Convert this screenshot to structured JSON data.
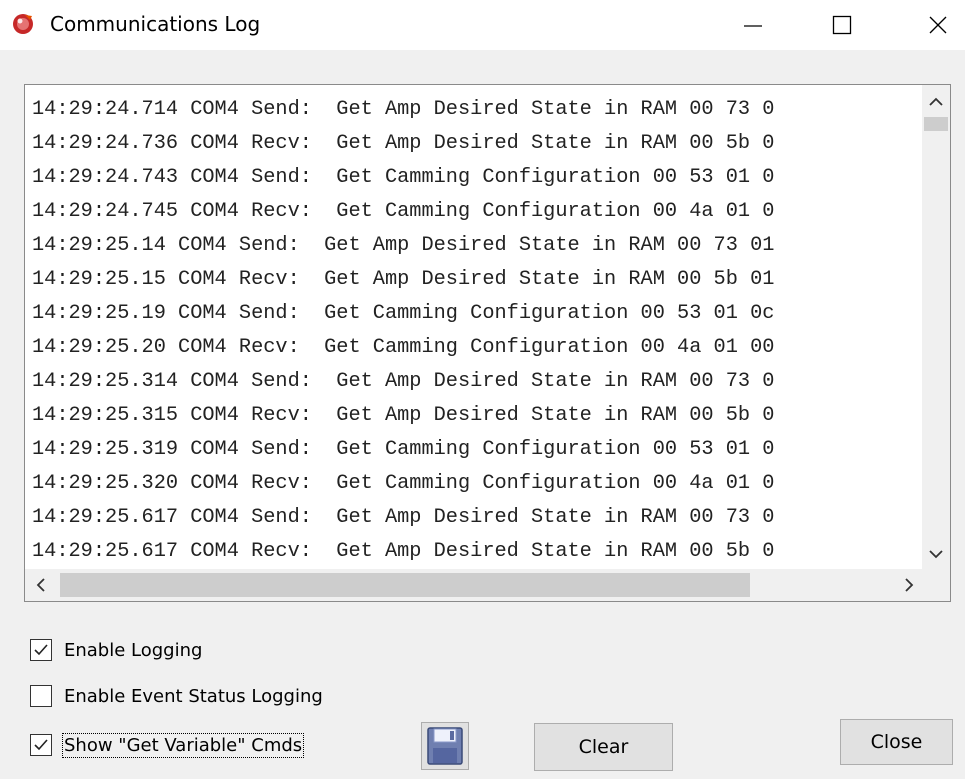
{
  "window": {
    "title": "Communications Log",
    "app_icon": "red-circle-app-icon",
    "controls": [
      "minimize-icon",
      "maximize-icon",
      "close-icon"
    ]
  },
  "log": {
    "lines": [
      "14:29:24.714 COM4 Send:  Get Amp Desired State in RAM 00 73 0",
      "14:29:24.736 COM4 Recv:  Get Amp Desired State in RAM 00 5b 0",
      "14:29:24.743 COM4 Send:  Get Camming Configuration 00 53 01 0",
      "14:29:24.745 COM4 Recv:  Get Camming Configuration 00 4a 01 0",
      "14:29:25.14 COM4 Send:  Get Amp Desired State in RAM 00 73 01",
      "14:29:25.15 COM4 Recv:  Get Amp Desired State in RAM 00 5b 01",
      "14:29:25.19 COM4 Send:  Get Camming Configuration 00 53 01 0c",
      "14:29:25.20 COM4 Recv:  Get Camming Configuration 00 4a 01 00",
      "14:29:25.314 COM4 Send:  Get Amp Desired State in RAM 00 73 0",
      "14:29:25.315 COM4 Recv:  Get Amp Desired State in RAM 00 5b 0",
      "14:29:25.319 COM4 Send:  Get Camming Configuration 00 53 01 0",
      "14:29:25.320 COM4 Recv:  Get Camming Configuration 00 4a 01 0",
      "14:29:25.617 COM4 Send:  Get Amp Desired State in RAM 00 73 0",
      "14:29:25.617 COM4 Recv:  Get Amp Desired State in RAM 00 5b 0"
    ]
  },
  "options": {
    "enable_logging": {
      "label": "Enable Logging",
      "checked": true
    },
    "enable_event_status_logging": {
      "label": "Enable Event Status Logging",
      "checked": false
    },
    "show_get_variable_cmds": {
      "label": "Show \"Get Variable\" Cmds",
      "checked": true
    }
  },
  "buttons": {
    "save_icon": "floppy-disk-icon",
    "clear": "Clear",
    "close": "Close"
  },
  "colors": {
    "window_bg": "#f0f0f0",
    "titlebar_bg": "#ffffff",
    "button_bg": "#e1e1e1",
    "app_icon_red": "#c62828"
  }
}
